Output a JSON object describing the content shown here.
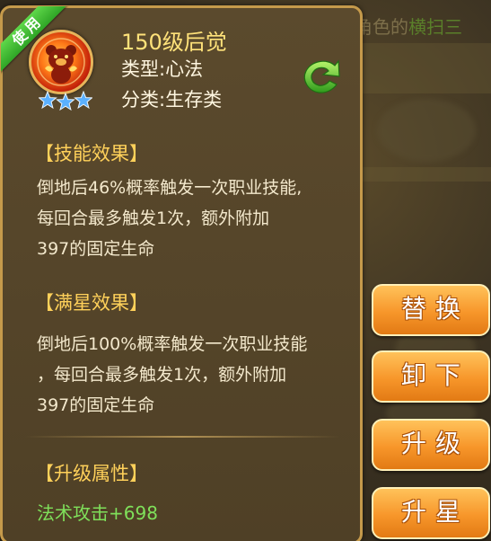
{
  "background": {
    "top_text_prefix": "角色的",
    "top_text_highlight": "横扫三"
  },
  "badge": {
    "label": "使用"
  },
  "skill": {
    "name": "150级后觉",
    "type_line": "类型:心法",
    "category_line": "分类:生存类",
    "star_count": 3,
    "icon": "fiery-bear-skill-icon"
  },
  "sections": {
    "effect": {
      "heading": "【技能效果】",
      "lines": [
        "倒地后46%概率触发一次职业技能,",
        "每回合最多触发1次，额外附加",
        "397的固定生命"
      ]
    },
    "max_star": {
      "heading": "【满星效果】",
      "lines": [
        "倒地后100%概率触发一次职业技能",
        "，每回合最多触发1次，额外附加",
        "397的固定生命"
      ]
    },
    "upgrade": {
      "heading": "【升级属性】",
      "attribute": "法术攻击+698"
    }
  },
  "actions": {
    "replace": "替换",
    "unequip": "卸下",
    "level_up": "升级",
    "star_up": "升星"
  },
  "colors": {
    "panel_border": "#c59a4b",
    "title": "#ffe27a",
    "section_heading": "#ffd15a",
    "attribute": "#7fe05a",
    "button": "#f7962a",
    "badge": "#3fbf30"
  }
}
